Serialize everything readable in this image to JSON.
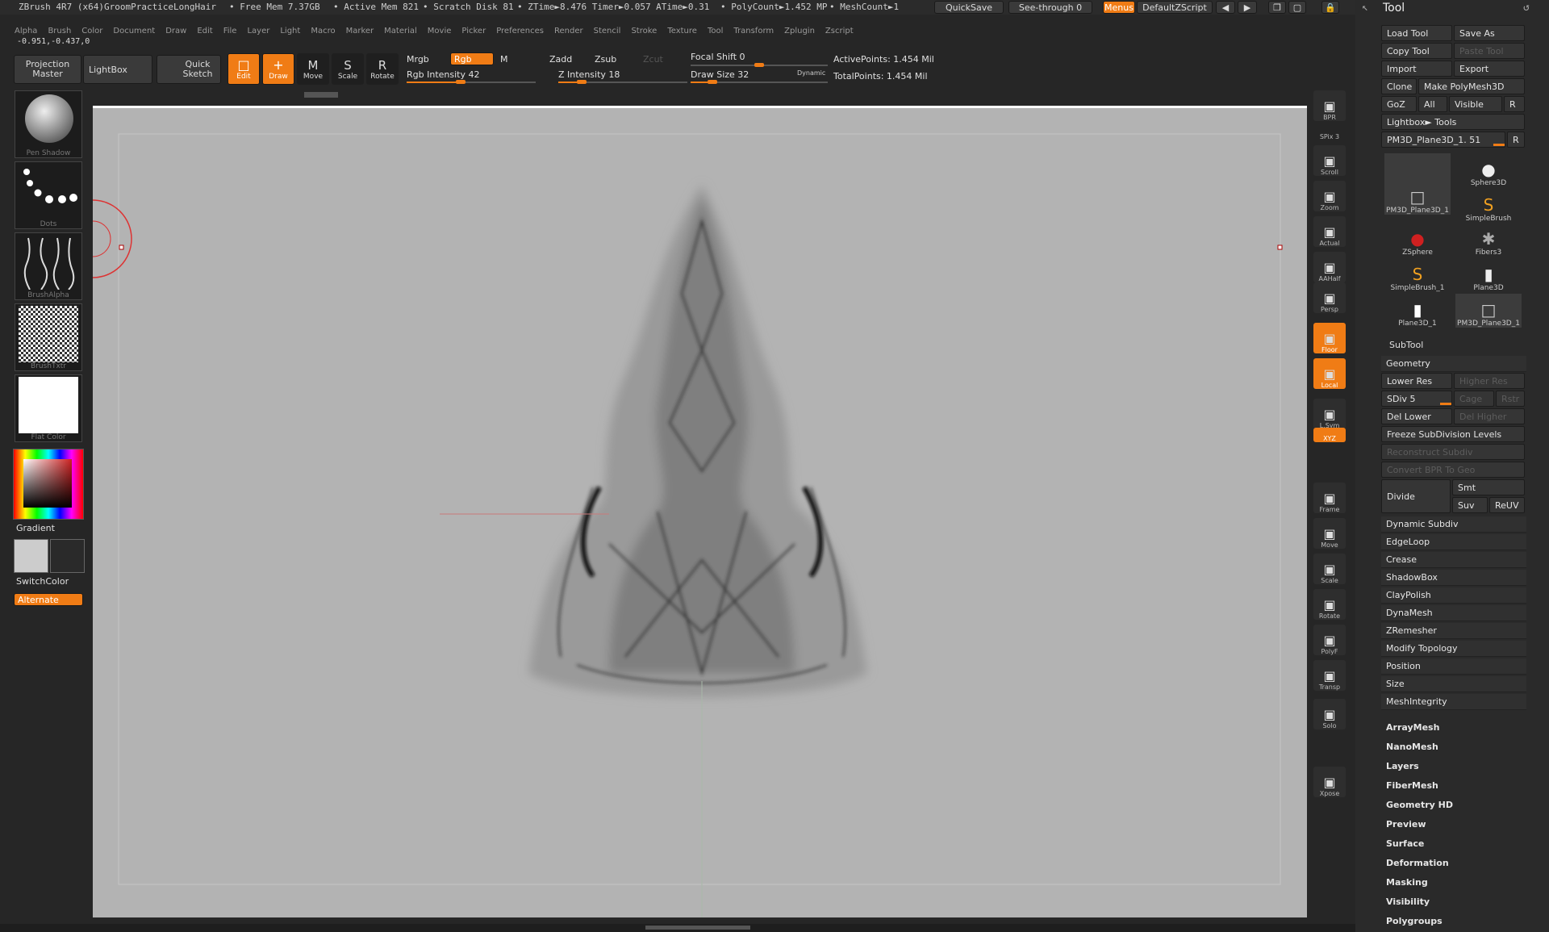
{
  "titlebar": {
    "app": "ZBrush 4R7 (x64)GroomPracticeLongHair",
    "free_mem": "• Free Mem 7.37GB",
    "active_mem": "• Active Mem 821",
    "scratch": "• Scratch Disk 81",
    "ztime": "• ZTime►8.476 Timer►0.057 ATime►0.31",
    "polycount": "• PolyCount►1.452 MP",
    "meshcount": "• MeshCount►1",
    "quicksave": "QuickSave",
    "seethrough": "See-through 0",
    "menus": "Menus",
    "defaultzscript": "DefaultZScript"
  },
  "menubar": [
    "Alpha",
    "Brush",
    "Color",
    "Document",
    "Draw",
    "Edit",
    "File",
    "Layer",
    "Light",
    "Macro",
    "Marker",
    "Material",
    "Movie",
    "Picker",
    "Preferences",
    "Render",
    "Stencil",
    "Stroke",
    "Texture",
    "Tool",
    "Transform",
    "Zplugin",
    "Zscript"
  ],
  "coords": "-0.951,-0.437,0",
  "toolbar": {
    "projection_master": "Projection Master",
    "lightbox": "LightBox",
    "quick_sketch": "Quick Sketch",
    "edit": "Edit",
    "draw": "Draw",
    "move": "Move",
    "scale": "Scale",
    "rotate": "Rotate",
    "mrgb": "Mrgb",
    "rgb": "Rgb",
    "m": "M",
    "rgb_intensity": "Rgb Intensity 42",
    "zadd": "Zadd",
    "zsub": "Zsub",
    "zcut": "Zcut",
    "z_intensity": "Z Intensity 18",
    "focal_shift": "Focal Shift 0",
    "draw_size": "Draw Size 32",
    "dynamic": "Dynamic",
    "active_points": "ActivePoints: 1.454 Mil",
    "total_points": "TotalPoints: 1.454 Mil",
    "rgb_intensity_value": 42,
    "z_intensity_value": 18,
    "draw_size_value": 32
  },
  "left_shelf": {
    "tiles": [
      "Pen Shadow",
      "Dots",
      "BrushAlpha",
      "BrushTxtr",
      "Flat Color"
    ],
    "gradient": "Gradient",
    "switch_color": "SwitchColor",
    "alternate": "Alternate"
  },
  "right_shelf": [
    {
      "label": "BPR",
      "icon": "render-icon"
    },
    {
      "label": "SPix 3",
      "icon": "spix-icon"
    },
    {
      "label": "Scroll",
      "icon": "scroll-icon"
    },
    {
      "label": "Zoom",
      "icon": "zoom-icon"
    },
    {
      "label": "Actual",
      "icon": "actual-icon"
    },
    {
      "label": "AAHalf",
      "icon": "aahalf-icon"
    },
    {
      "label": "Persp",
      "icon": "persp-icon"
    },
    {
      "label": "Floor",
      "icon": "floor-icon"
    },
    {
      "label": "Local",
      "icon": "local-icon"
    },
    {
      "label": "L.Sym",
      "icon": "lsym-icon"
    },
    {
      "label": "XYZ",
      "icon": "xyz-icon"
    },
    {
      "label": "Frame",
      "icon": "frame-icon"
    },
    {
      "label": "Move",
      "icon": "move-icon"
    },
    {
      "label": "Scale",
      "icon": "scale-icon"
    },
    {
      "label": "Rotate",
      "icon": "rotate-icon"
    },
    {
      "label": "PolyF",
      "icon": "polyf-icon"
    },
    {
      "label": "Transp",
      "icon": "transp-icon"
    },
    {
      "label": "Solo",
      "icon": "solo-icon"
    },
    {
      "label": "Xpose",
      "icon": "xpose-icon"
    }
  ],
  "tool_panel": {
    "title": "Tool",
    "load_tool": "Load Tool",
    "save_as": "Save As",
    "copy_tool": "Copy Tool",
    "paste_tool": "Paste Tool",
    "import": "Import",
    "export": "Export",
    "clone": "Clone",
    "make_polymesh": "Make PolyMesh3D",
    "goz": "GoZ",
    "all": "All",
    "visible": "Visible",
    "r": "R",
    "lightbox_tools": "Lightbox► Tools",
    "current_tool": "PM3D_Plane3D_1. 51",
    "thumbs": [
      "PM3D_Plane3D_1",
      "Sphere3D",
      "SimpleBrush",
      "ZSphere",
      "Fibers3",
      "SimpleBrush_1",
      "Plane3D",
      "Plane3D_1",
      "PM3D_Plane3D_1"
    ],
    "subtool": "SubTool",
    "geometry": "Geometry",
    "lower_res": "Lower Res",
    "higher_res": "Higher Res",
    "sdiv": "SDiv 5",
    "cage": "Cage",
    "rstr": "Rstr",
    "del_lower": "Del Lower",
    "del_higher": "Del Higher",
    "freeze": "Freeze SubDivision Levels",
    "reconstruct": "Reconstruct Subdiv",
    "convert_bpr": "Convert BPR To Geo",
    "divide": "Divide",
    "smt": "Smt",
    "suv": "Suv",
    "reuv": "ReUV",
    "geometry_items": [
      "Dynamic Subdiv",
      "EdgeLoop",
      "Crease",
      "ShadowBox",
      "ClayPolish",
      "DynaMesh",
      "ZRemesher",
      "Modify Topology",
      "Position",
      "Size",
      "MeshIntegrity"
    ],
    "sections": [
      "ArrayMesh",
      "NanoMesh",
      "Layers",
      "FiberMesh",
      "Geometry HD",
      "Preview",
      "Surface",
      "Deformation",
      "Masking",
      "Visibility",
      "Polygroups"
    ]
  }
}
